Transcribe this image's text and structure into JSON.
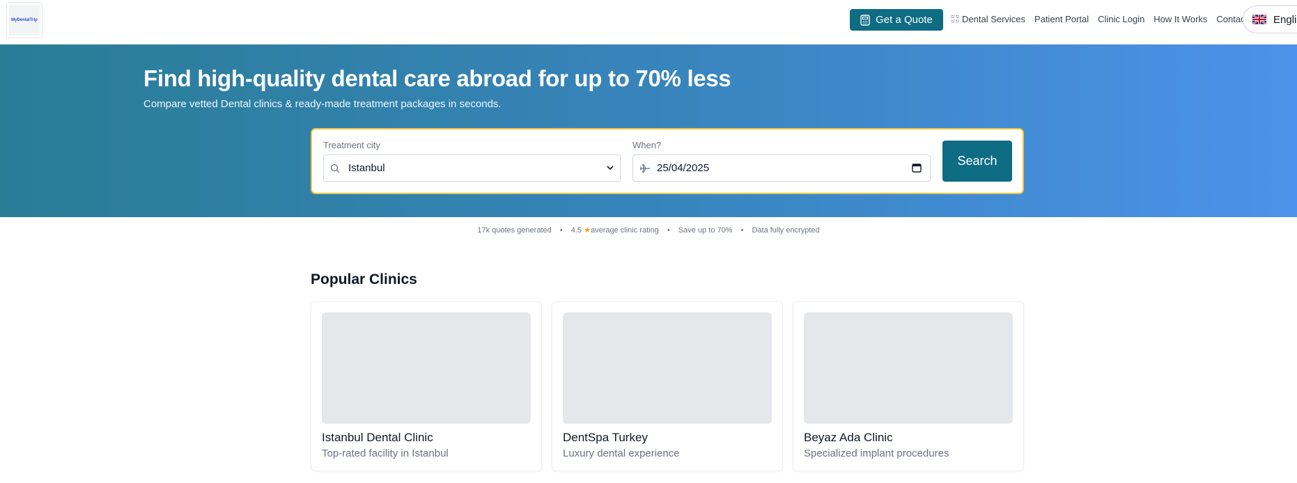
{
  "header": {
    "logo_text": "MyDentalTrip",
    "quote_label": "Get a Quote",
    "nav": [
      {
        "label": "Dental Services"
      },
      {
        "label": "Patient Portal"
      },
      {
        "label": "Clinic Login"
      },
      {
        "label": "How It Works"
      },
      {
        "label": "Contact"
      }
    ],
    "language_label": "English"
  },
  "hero": {
    "title": "Find high-quality dental care abroad for up to 70% less",
    "subtitle": "Compare vetted Dental clinics & ready-made treatment packages in seconds."
  },
  "search": {
    "city_label": "Treatment city",
    "city_value": "Istanbul",
    "date_label": "When?",
    "date_value": "25/04/2025",
    "button_label": "Search"
  },
  "stats": {
    "quotes": "17k quotes generated",
    "rating_value": "4.5",
    "rating_text": "average clinic rating",
    "save": "Save up to 70%",
    "security": "Data fully encrypted"
  },
  "popular": {
    "title": "Popular Clinics",
    "clinics": [
      {
        "name": "Istanbul Dental Clinic",
        "desc": "Top-rated facility in Istanbul"
      },
      {
        "name": "DentSpa Turkey",
        "desc": "Luxury dental experience"
      },
      {
        "name": "Beyaz Ada Clinic",
        "desc": "Specialized implant procedures"
      }
    ]
  },
  "colors": {
    "primary": "#0e6c83",
    "accent_border": "#f0c340",
    "hero_start": "#297d95",
    "hero_end": "#4c92ea"
  }
}
